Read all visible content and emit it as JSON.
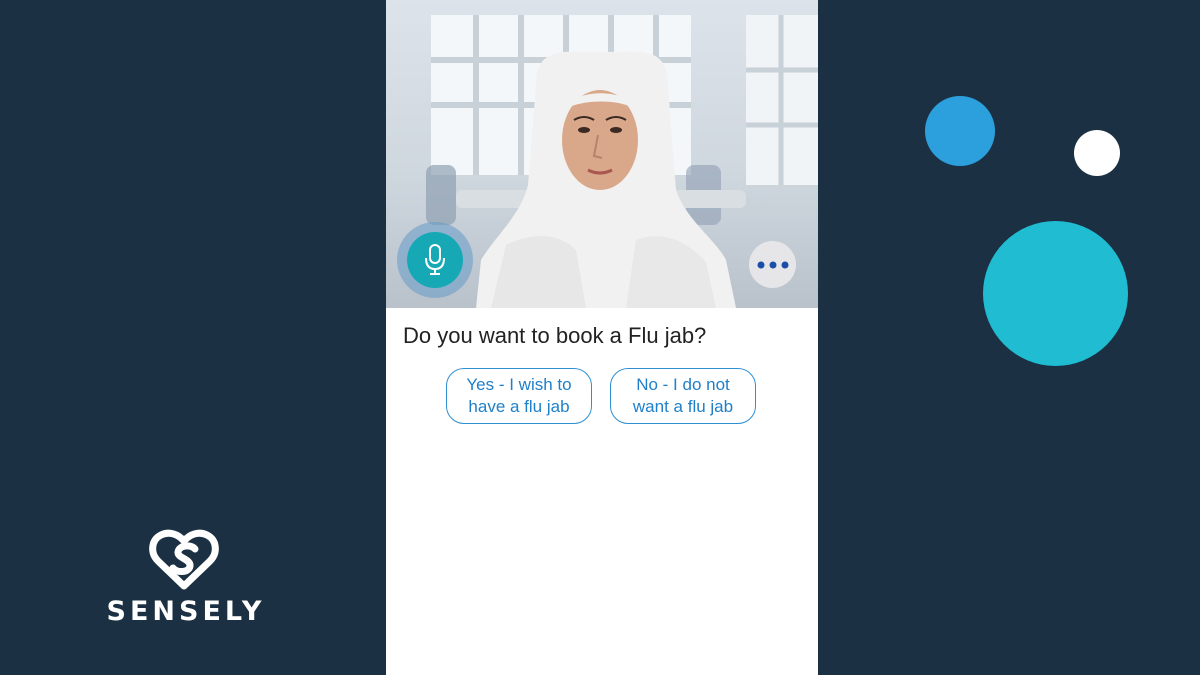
{
  "brand": {
    "name": "SENSELY",
    "logo_icon": "heart-logo-icon",
    "logo_color": "#ffffff"
  },
  "background": {
    "color": "#1b3042",
    "decorative_circle_colors": [
      "#2c9fdd",
      "#ffffff",
      "#1fbcd2"
    ]
  },
  "chat": {
    "avatar": "virtual-nurse-avatar",
    "mic_icon": "microphone-icon",
    "more_icon": "more-dots-icon",
    "accent_color": "#16a9b5",
    "question": "Do you want to book a Flu jab?",
    "options": [
      {
        "label": "Yes - I wish to have a flu jab"
      },
      {
        "label": "No - I do not want a flu jab"
      }
    ],
    "option_color": "#1f80c9"
  }
}
